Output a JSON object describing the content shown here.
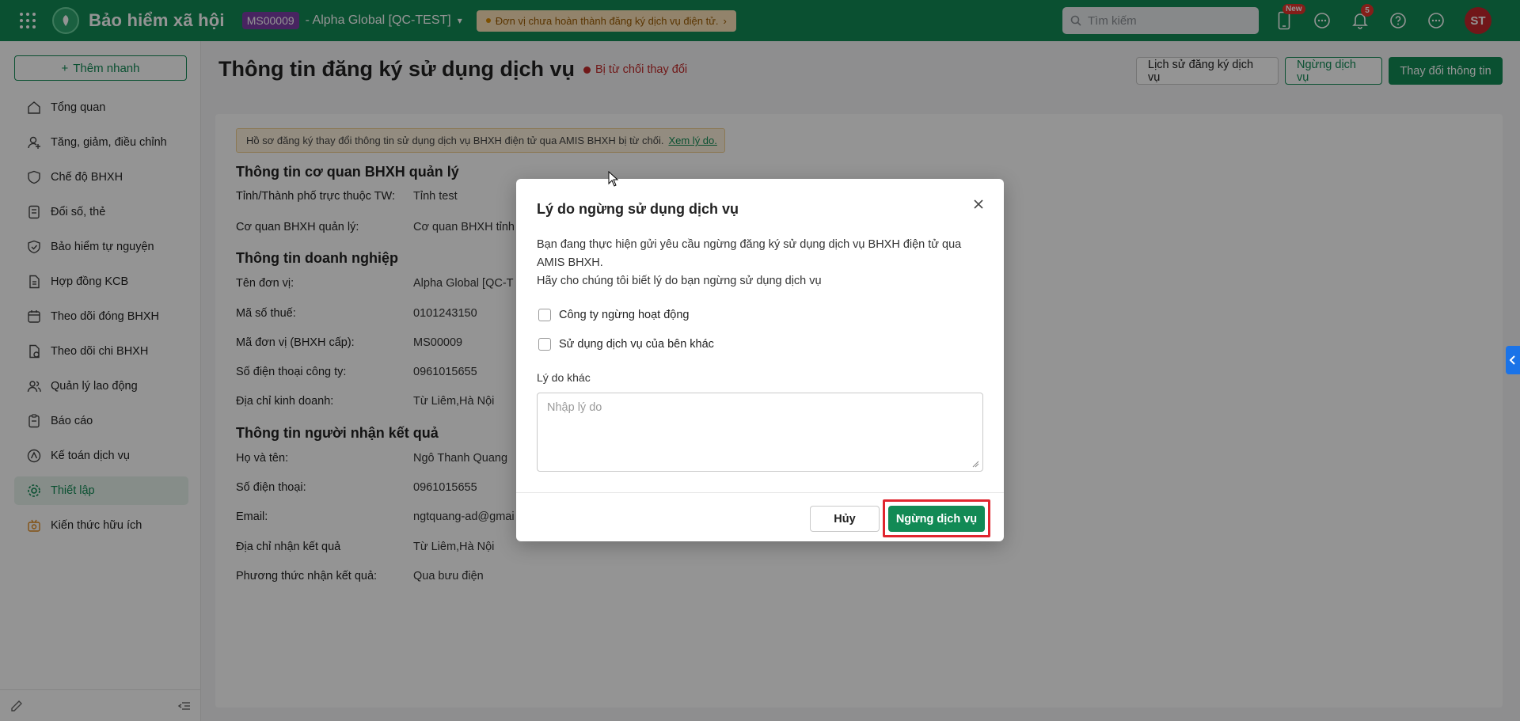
{
  "header": {
    "brand": "Bảo hiểm xã hội",
    "org_code": "MS00009",
    "org_name": "- Alpha Global [QC-TEST]",
    "warning": "Đơn vị chưa hoàn thành đăng ký dịch vụ điện tử.",
    "search_placeholder": "Tìm kiếm",
    "new_badge": "New",
    "notif_count": "5",
    "avatar": "ST"
  },
  "sidebar": {
    "add_label": "Thêm nhanh",
    "items": [
      {
        "label": "Tổng quan",
        "icon": "home-icon"
      },
      {
        "label": "Tăng, giảm, điều chỉnh",
        "icon": "user-adjust-icon"
      },
      {
        "label": "Chế độ BHXH",
        "icon": "shield-heart-icon"
      },
      {
        "label": "Đổi số, thẻ",
        "icon": "card-icon"
      },
      {
        "label": "Bảo hiểm tự nguyện",
        "icon": "shield-icon"
      },
      {
        "label": "Hợp đồng KCB",
        "icon": "contract-icon"
      },
      {
        "label": "Theo dõi đóng BHXH",
        "icon": "calendar-icon"
      },
      {
        "label": "Theo dõi chi BHXH",
        "icon": "document-money-icon"
      },
      {
        "label": "Quản lý lao động",
        "icon": "users-icon"
      },
      {
        "label": "Báo cáo",
        "icon": "report-icon"
      },
      {
        "label": "Kế toán dịch vụ",
        "icon": "accounting-icon"
      },
      {
        "label": "Thiết lập",
        "icon": "gear-icon"
      },
      {
        "label": "Kiến thức hữu ích",
        "icon": "knowledge-icon"
      }
    ]
  },
  "main": {
    "title": "Thông tin đăng ký sử dụng dịch vụ",
    "status": "Bị từ chối thay đổi",
    "btn_history": "Lịch sử đăng ký dịch vụ",
    "btn_stop": "Ngừng dịch vụ",
    "btn_change": "Thay đổi thông tin",
    "notice": "Hồ sơ đăng ký thay đổi thông tin sử dụng dịch vụ BHXH điện tử qua AMIS BHXH bị từ chối.",
    "notice_link": "Xem lý do.",
    "sections": {
      "agency_title": "Thông tin cơ quan BHXH quản lý",
      "agency": [
        {
          "label": "Tỉnh/Thành phố trực thuộc TW:",
          "value": "Tỉnh test"
        },
        {
          "label": "Cơ quan BHXH quản lý:",
          "value": "Cơ quan BHXH tỉnh t"
        }
      ],
      "company_title": "Thông tin doanh nghiệp",
      "company": [
        {
          "label": "Tên đơn vị:",
          "value": "Alpha Global [QC-T"
        },
        {
          "label": "Mã số thuế:",
          "value": "0101243150"
        },
        {
          "label": "Mã đơn vị (BHXH cấp):",
          "value": "MS00009"
        },
        {
          "label": "Số điện thoại công ty:",
          "value": "0961015655"
        },
        {
          "label": "Địa chỉ kinh doanh:",
          "value": "Từ Liêm,Hà Nội"
        }
      ],
      "receiver_title": "Thông tin người nhận kết quả",
      "receiver": [
        {
          "label": "Họ và tên:",
          "value": "Ngô Thanh Quang"
        },
        {
          "label": "Số điện thoại:",
          "value": "0961015655"
        },
        {
          "label": "Email:",
          "value": "ngtquang-ad@gmai"
        },
        {
          "label": "Địa chỉ nhận kết quả",
          "value": "Từ Liêm,Hà Nội"
        },
        {
          "label": "Phương thức nhận kết quả:",
          "value": "Qua bưu điện"
        }
      ]
    }
  },
  "modal": {
    "title": "Lý do ngừng sử dụng dịch vụ",
    "desc1": "Bạn đang thực hiện gửi yêu cầu ngừng đăng ký sử dụng dịch vụ BHXH điện tử qua AMIS BHXH.",
    "desc2": "Hãy cho chúng tôi biết lý do bạn ngừng sử dụng dịch vụ",
    "option1": "Công ty ngừng hoạt động",
    "option2": "Sử dụng dịch vụ của bên khác",
    "other_label": "Lý do khác",
    "other_placeholder": "Nhập lý do",
    "cancel": "Hủy",
    "confirm": "Ngừng dịch vụ"
  },
  "colors": {
    "brand_green": "#128a55",
    "danger": "#c22a2a",
    "highlight": "#e0262f"
  }
}
